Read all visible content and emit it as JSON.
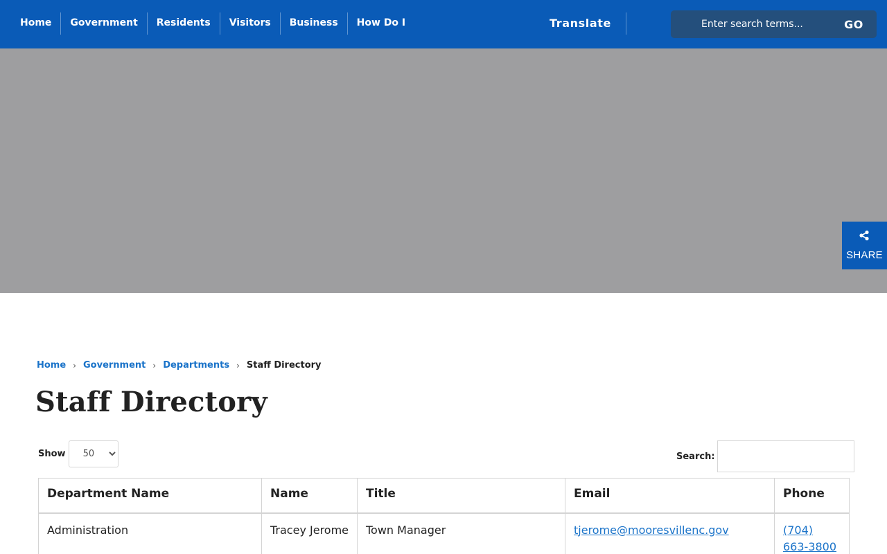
{
  "nav": {
    "items": [
      "Home",
      "Government",
      "Residents",
      "Visitors",
      "Business",
      "How Do I"
    ],
    "translate": "Translate",
    "search_placeholder": "Enter search terms...",
    "go": "GO"
  },
  "share": {
    "label": "SHARE",
    "icon": "share-icon"
  },
  "breadcrumb": {
    "items": [
      "Home",
      "Government",
      "Departments"
    ],
    "current": "Staff Directory"
  },
  "page": {
    "title": "Staff Directory"
  },
  "controls": {
    "show_label": "Show",
    "show_value": "50",
    "search_label": "Search:"
  },
  "table": {
    "headers": [
      "Department Name",
      "Name",
      "Title",
      "Email",
      "Phone"
    ],
    "rows": [
      [
        "Administration",
        "Tracey Jerome",
        "Town Manager",
        "tjerome@mooresvillenc.gov",
        "(704) 663-3800"
      ]
    ]
  },
  "colors": {
    "brand": "#0a5bb7",
    "link": "#1a73c9",
    "hero": "#9e9ea0"
  }
}
